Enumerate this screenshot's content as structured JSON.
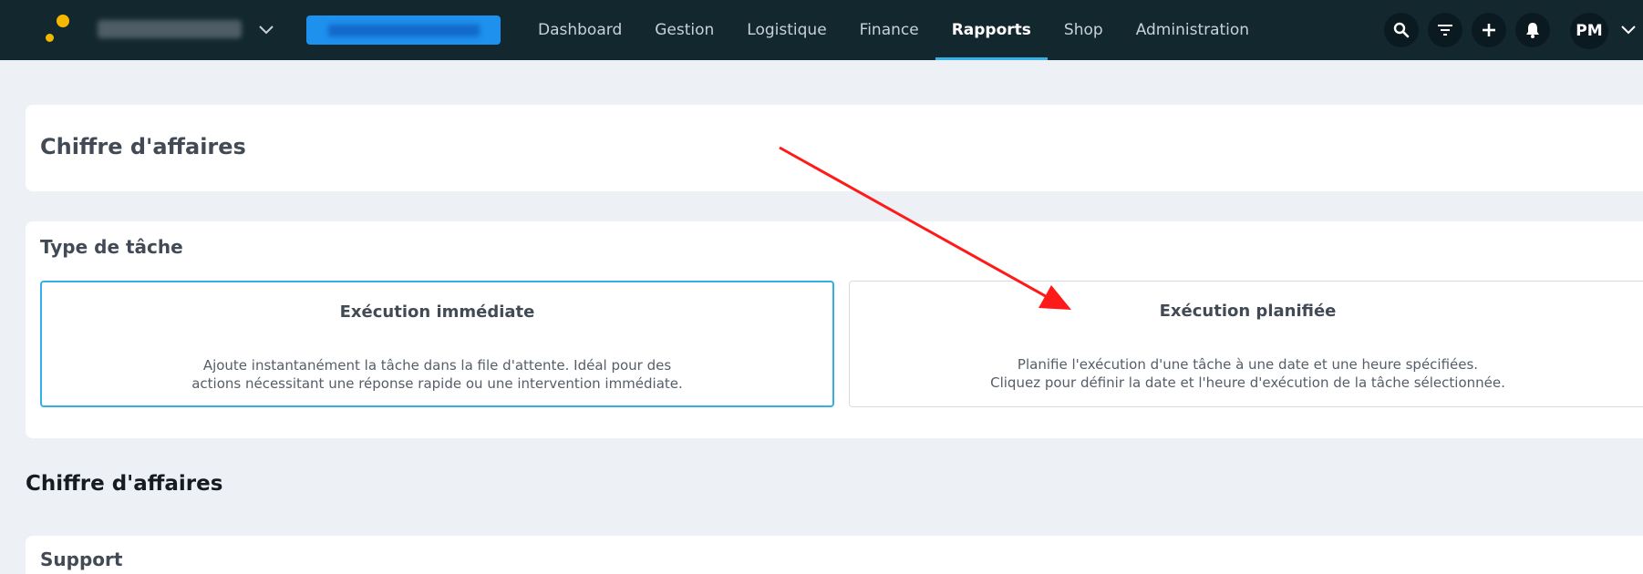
{
  "header": {
    "nav": [
      {
        "label": "Dashboard"
      },
      {
        "label": "Gestion"
      },
      {
        "label": "Logistique"
      },
      {
        "label": "Finance"
      },
      {
        "label": "Rapports",
        "active": true
      },
      {
        "label": "Shop"
      },
      {
        "label": "Administration"
      }
    ],
    "icons": [
      "search-icon",
      "filter-icon",
      "plus-icon",
      "bell-icon",
      "chevron-down-icon"
    ],
    "avatar_initials": "PM",
    "colors": {
      "topbar": "#13272f",
      "accent": "#35b3e8",
      "logo": "#f5b800",
      "button": "#1e90ee"
    }
  },
  "report": {
    "title": "Chiffre d'affaires"
  },
  "task_type": {
    "heading": "Type de tâche",
    "options": [
      {
        "title": "Exécution immédiate",
        "description_lines": [
          "Ajoute instantanément la tâche dans la file d'attente. Idéal pour des",
          "actions nécessitant une réponse rapide ou une intervention immédiate."
        ],
        "selected": true
      },
      {
        "title": "Exécution planifiée",
        "description_lines": [
          "Planifie l'exécution d'une tâche à une date et une heure spécifiées.",
          "Cliquez pour définir la date et l'heure d'exécution de la tâche sélectionnée."
        ],
        "selected": false
      }
    ]
  },
  "section": {
    "title": "Chiffre d'affaires"
  },
  "support": {
    "heading": "Support"
  },
  "annotation": {
    "type": "arrow",
    "color": "#ff0000"
  }
}
